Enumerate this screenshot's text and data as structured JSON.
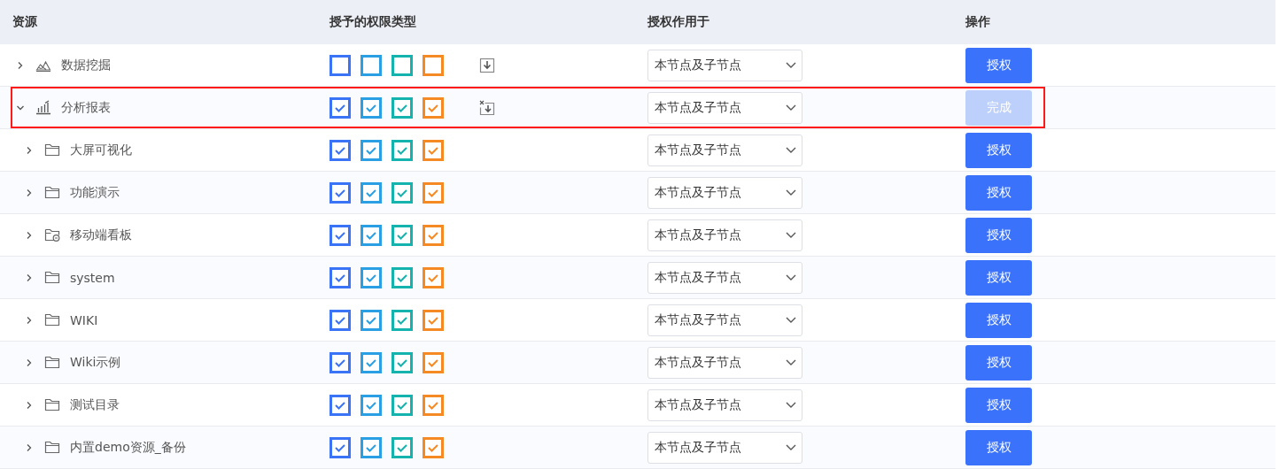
{
  "header": {
    "columns": [
      "资源",
      "授予的权限类型",
      "授权作用于",
      "操作"
    ]
  },
  "rows": [
    {
      "name": "数据挖掘",
      "kind": "mining",
      "expanded": false,
      "editing": false,
      "export": {
        "kind": "plain"
      },
      "scope": "本节点及子节点",
      "action": {
        "label": "授权",
        "disabled": false
      },
      "permissions": [
        {
          "checked": false,
          "color": "#3b73f6"
        },
        {
          "checked": false,
          "color": "#2b9fe3"
        },
        {
          "checked": false,
          "color": "#14b3ad"
        },
        {
          "checked": false,
          "color": "#f58a25"
        }
      ]
    },
    {
      "name": "分析报表",
      "kind": "chart",
      "expanded": true,
      "editing": true,
      "export": {
        "kind": "crossed"
      },
      "scope": "本节点及子节点",
      "action": {
        "label": "完成",
        "disabled": true
      },
      "permissions": [
        {
          "checked": true,
          "color": "#3b73f6"
        },
        {
          "checked": true,
          "color": "#2b9fe3"
        },
        {
          "checked": true,
          "color": "#14b3ad"
        },
        {
          "checked": true,
          "color": "#f58a25"
        }
      ],
      "children": [
        {
          "name": "大屏可视化",
          "kind": "folder",
          "expanded": false,
          "editing": false,
          "scope": "本节点及子节点",
          "action": {
            "label": "授权",
            "disabled": false
          },
          "permissions": [
            {
              "checked": true,
              "color": "#3b73f6"
            },
            {
              "checked": true,
              "color": "#2b9fe3"
            },
            {
              "checked": true,
              "color": "#14b3ad"
            },
            {
              "checked": true,
              "color": "#f58a25"
            }
          ]
        },
        {
          "name": "功能演示",
          "kind": "folder",
          "expanded": false,
          "editing": false,
          "scope": "本节点及子节点",
          "action": {
            "label": "授权",
            "disabled": false
          },
          "permissions": [
            {
              "checked": true,
              "color": "#3b73f6"
            },
            {
              "checked": true,
              "color": "#2b9fe3"
            },
            {
              "checked": true,
              "color": "#14b3ad"
            },
            {
              "checked": true,
              "color": "#f58a25"
            }
          ]
        },
        {
          "name": "移动端看板",
          "kind": "mobile",
          "expanded": false,
          "editing": false,
          "scope": "本节点及子节点",
          "action": {
            "label": "授权",
            "disabled": false
          },
          "permissions": [
            {
              "checked": true,
              "color": "#3b73f6"
            },
            {
              "checked": true,
              "color": "#2b9fe3"
            },
            {
              "checked": true,
              "color": "#14b3ad"
            },
            {
              "checked": true,
              "color": "#f58a25"
            }
          ]
        },
        {
          "name": "system",
          "kind": "folder",
          "expanded": false,
          "editing": false,
          "scope": "本节点及子节点",
          "action": {
            "label": "授权",
            "disabled": false
          },
          "permissions": [
            {
              "checked": true,
              "color": "#3b73f6"
            },
            {
              "checked": true,
              "color": "#2b9fe3"
            },
            {
              "checked": true,
              "color": "#14b3ad"
            },
            {
              "checked": true,
              "color": "#f58a25"
            }
          ]
        },
        {
          "name": "WIKI",
          "kind": "folder",
          "expanded": false,
          "editing": false,
          "scope": "本节点及子节点",
          "action": {
            "label": "授权",
            "disabled": false
          },
          "permissions": [
            {
              "checked": true,
              "color": "#3b73f6"
            },
            {
              "checked": true,
              "color": "#2b9fe3"
            },
            {
              "checked": true,
              "color": "#14b3ad"
            },
            {
              "checked": true,
              "color": "#f58a25"
            }
          ]
        },
        {
          "name": "Wiki示例",
          "kind": "folder",
          "expanded": false,
          "editing": false,
          "scope": "本节点及子节点",
          "action": {
            "label": "授权",
            "disabled": false
          },
          "permissions": [
            {
              "checked": true,
              "color": "#3b73f6"
            },
            {
              "checked": true,
              "color": "#2b9fe3"
            },
            {
              "checked": true,
              "color": "#14b3ad"
            },
            {
              "checked": true,
              "color": "#f58a25"
            }
          ]
        },
        {
          "name": "测试目录",
          "kind": "folder",
          "expanded": false,
          "editing": false,
          "scope": "本节点及子节点",
          "action": {
            "label": "授权",
            "disabled": false
          },
          "permissions": [
            {
              "checked": true,
              "color": "#3b73f6"
            },
            {
              "checked": true,
              "color": "#2b9fe3"
            },
            {
              "checked": true,
              "color": "#14b3ad"
            },
            {
              "checked": true,
              "color": "#f58a25"
            }
          ]
        },
        {
          "name": "内置demo资源_备份",
          "kind": "folder",
          "expanded": false,
          "editing": false,
          "scope": "本节点及子节点",
          "action": {
            "label": "授权",
            "disabled": false
          },
          "permissions": [
            {
              "checked": true,
              "color": "#3b73f6"
            },
            {
              "checked": true,
              "color": "#2b9fe3"
            },
            {
              "checked": true,
              "color": "#14b3ad"
            },
            {
              "checked": true,
              "color": "#f58a25"
            }
          ]
        }
      ]
    }
  ]
}
